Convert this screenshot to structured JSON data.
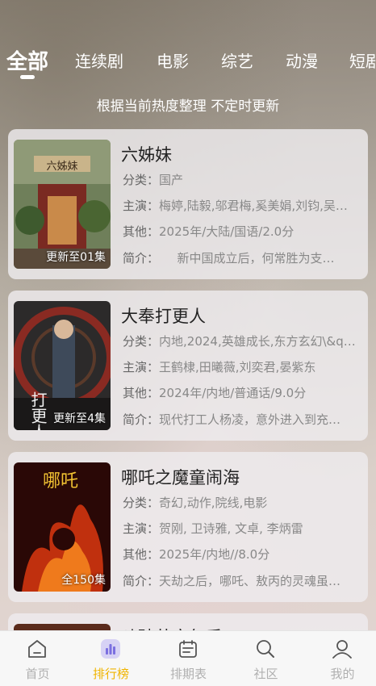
{
  "tabs": [
    {
      "label": "全部",
      "active": true
    },
    {
      "label": "连续剧",
      "active": false
    },
    {
      "label": "电影",
      "active": false
    },
    {
      "label": "综艺",
      "active": false
    },
    {
      "label": "动漫",
      "active": false
    },
    {
      "label": "短剧",
      "active": false
    }
  ],
  "subtitle": "根据当前热度整理 不定时更新",
  "cards": [
    {
      "title": "六姊妹",
      "poster_label": "更新至01集",
      "poster_text": "六姊妹",
      "category_key": "分类：",
      "category": "国产",
      "cast_key": "主演：",
      "cast": "梅婷,陆毅,邬君梅,奚美娟,刘钧,吴…",
      "other_key": "其他：",
      "other": "2025年/大陆/国语/2.0分",
      "intro_key": "简介：",
      "intro": "　　新中国成立后，何常胜为支…"
    },
    {
      "title": "大奉打更人",
      "poster_label": "更新至4集",
      "poster_text": "打更人",
      "category_key": "分类：",
      "category": "内地,2024,英雄成长,东方玄幻\\&q…",
      "cast_key": "主演：",
      "cast": "王鹤棣,田曦薇,刘奕君,晏紫东",
      "other_key": "其他：",
      "other": "2024年/内地/普通话/9.0分",
      "intro_key": "简介：",
      "intro": "现代打工人杨凌，意外进入到充…"
    },
    {
      "title": "哪吒之魔童闹海",
      "poster_label": "全150集",
      "poster_text": "哪吒",
      "category_key": "分类：",
      "category": "奇幻,动作,院线,电影",
      "cast_key": "主演：",
      "cast": "贺刚, 卫诗雅, 文卓, 李炳雷",
      "other_key": "其他：",
      "other": "2025年/内地//8.0分",
      "intro_key": "简介：",
      "intro": "天劫之后，哪吒、敖丙的灵魂虽…"
    }
  ],
  "peek_title": "斗破苍穹年番",
  "nav": [
    {
      "label": "首页",
      "icon": "home-icon",
      "active": false
    },
    {
      "label": "排行榜",
      "icon": "ranking-icon",
      "active": true
    },
    {
      "label": "排期表",
      "icon": "schedule-icon",
      "active": false
    },
    {
      "label": "社区",
      "icon": "search-icon",
      "active": false
    },
    {
      "label": "我的",
      "icon": "profile-icon",
      "active": false
    }
  ],
  "colors": {
    "accent": "#f0b400",
    "nav_inactive": "#b0b0b0"
  }
}
